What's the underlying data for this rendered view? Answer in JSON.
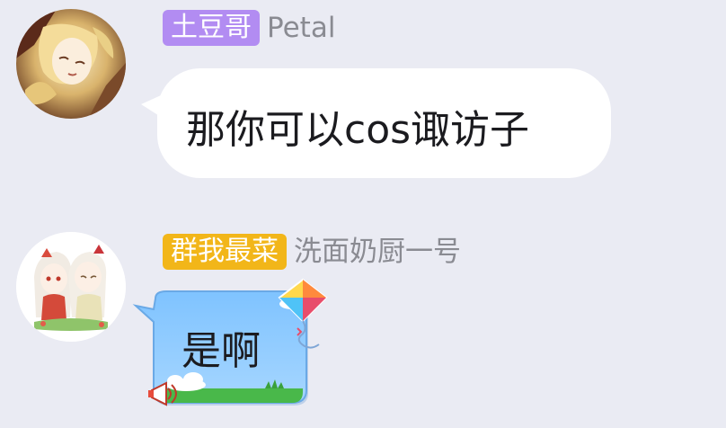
{
  "messages": [
    {
      "sender_badge": "土豆哥",
      "sender_name": "Petal",
      "text": "那你可以cos诹访子",
      "badge_color": "#b28cf2",
      "bubble_style": "white"
    },
    {
      "sender_badge": "群我最菜",
      "sender_name": "洗面奶厨一号",
      "text": "是啊",
      "badge_color": "#f2b619",
      "bubble_style": "kite-theme"
    }
  ],
  "icons": [
    "avatar-petal",
    "avatar-anime-girls",
    "kite-icon",
    "megaphone-icon",
    "cloud-icon",
    "grass-decoration"
  ]
}
